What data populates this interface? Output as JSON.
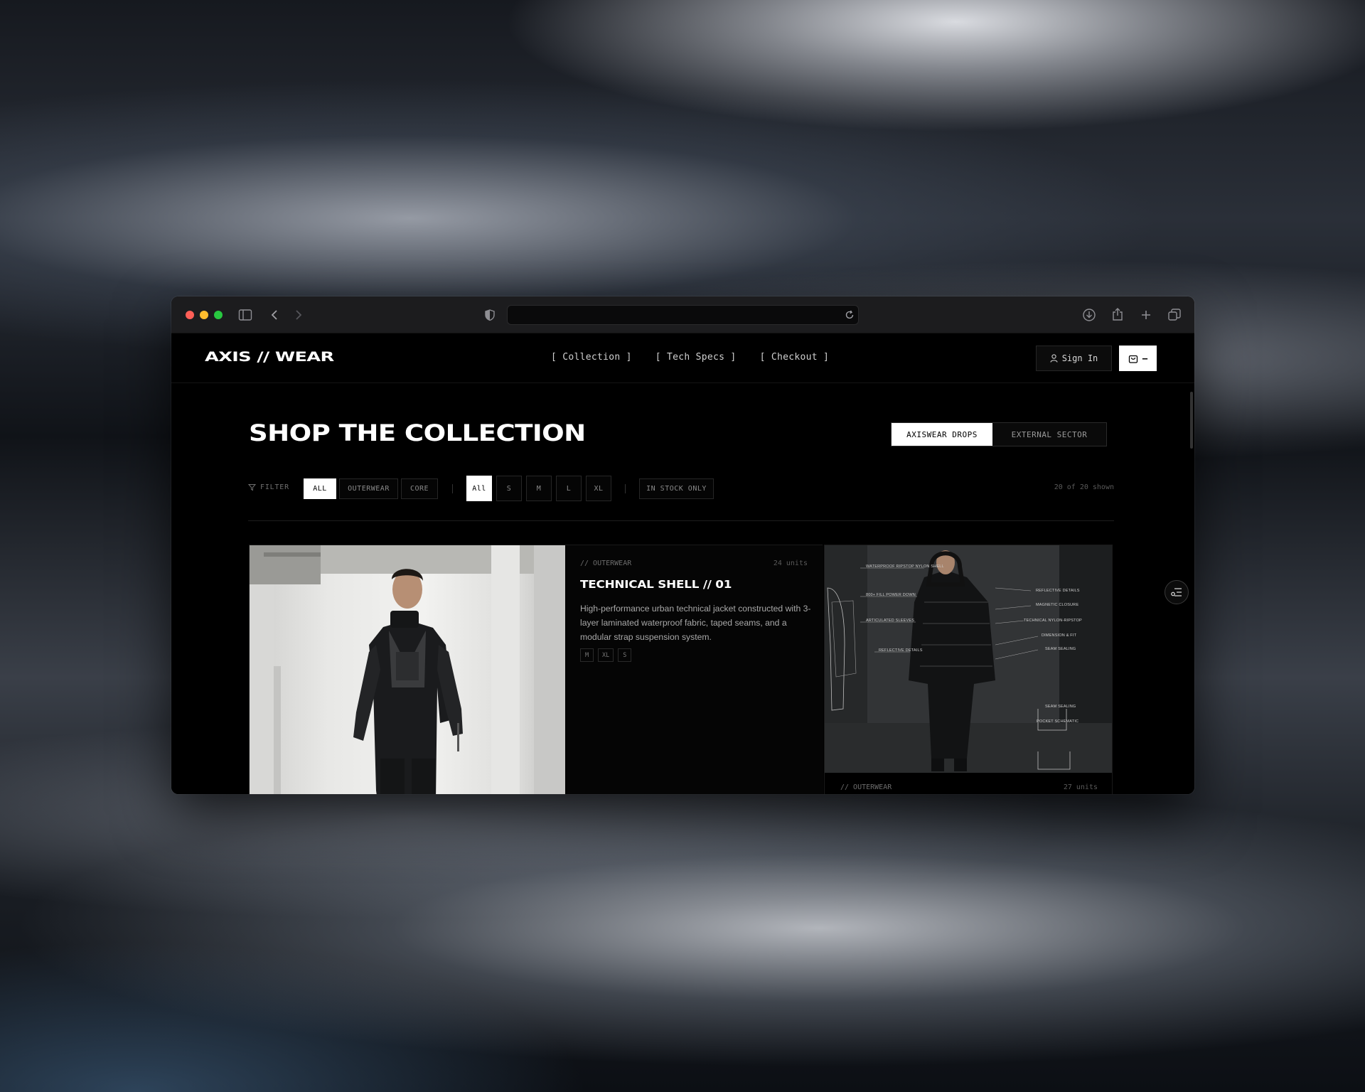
{
  "browser": {
    "traffic_lights": {
      "close": "#ff5f57",
      "minimize": "#febc2e",
      "zoom": "#28c840"
    },
    "url": "",
    "icons": [
      "sidebar-icon",
      "back-icon",
      "forward-icon",
      "shield-icon",
      "reload-icon",
      "download-icon",
      "share-icon",
      "new-tab-icon",
      "tabs-overview-icon"
    ]
  },
  "header": {
    "logo": "AXIS // WEAR",
    "nav": [
      "[ Collection ]",
      "[ Tech Specs ]",
      "[ Checkout ]"
    ],
    "sign_in": "Sign In",
    "cart_count": "–"
  },
  "page": {
    "title": "SHOP THE COLLECTION",
    "source_toggle": {
      "active": "AXISWEAR DROPS",
      "inactive": "EXTERNAL SECTOR"
    }
  },
  "filters": {
    "label": "FILTER",
    "categories": [
      "ALL",
      "OUTERWEAR",
      "CORE"
    ],
    "sizes": [
      "All",
      "S",
      "M",
      "L",
      "XL"
    ],
    "stock": "IN STOCK ONLY",
    "shown": "20 of 20 shown"
  },
  "products": [
    {
      "category": "// OUTERWEAR",
      "units": "24 units",
      "title": "TECHNICAL SHELL // 01",
      "description": "High-performance urban technical jacket constructed with 3-layer laminated waterproof fabric, taped seams, and a modular strap suspension system.",
      "sizes": [
        "M",
        "XL",
        "S"
      ]
    },
    {
      "category": "// OUTERWEAR",
      "units": "27 units",
      "annotations": [
        "WATERPROOF RIPSTOP NYLON SHELL",
        "800+ FILL POWER DOWN",
        "ARTICULATED SLEEVES",
        "REFLECTIVE DETAILS",
        "REFLECTIVE DETAILS",
        "MAGNETIC CLOSURE",
        "TECHNICAL NYLON-RIPSTOP",
        "DIMENSION & FIT",
        "SEAM SEALING",
        "SEAM SEALING",
        "POCKET SCHEMATIC"
      ]
    }
  ],
  "colors": {
    "accent": "#ffffff",
    "background": "#000000",
    "muted": "#8a8a8a"
  }
}
